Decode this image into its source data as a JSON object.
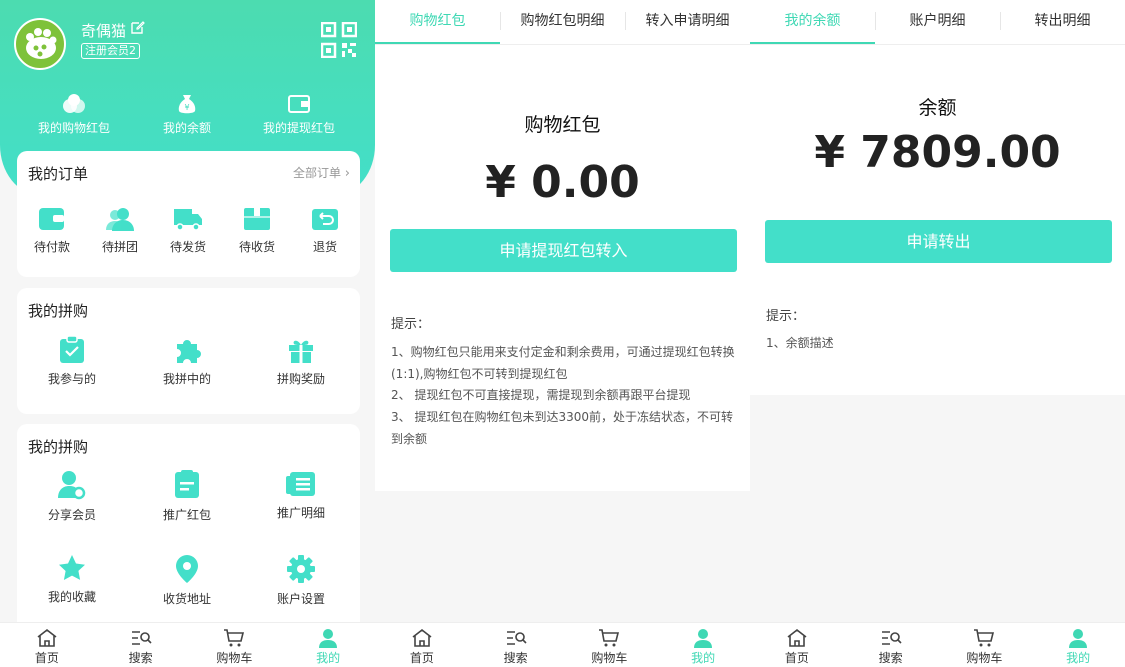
{
  "profile": {
    "username": "奇偶猫",
    "member_level": "注册会员2",
    "quick_links": [
      "我的购物红包",
      "我的余额",
      "我的提现红包"
    ]
  },
  "orders": {
    "title": "我的订单",
    "more": "全部订单",
    "items": [
      "待付款",
      "待拼团",
      "待发货",
      "待收货",
      "退货"
    ]
  },
  "group_buy": {
    "title": "我的拼购",
    "items": [
      "我参与的",
      "我拼中的",
      "拼购奖励"
    ]
  },
  "promo": {
    "title": "我的拼购",
    "items": [
      "分享会员",
      "推广红包",
      "推广明细",
      "我的收藏",
      "收货地址",
      "账户设置"
    ]
  },
  "tabbar": {
    "items": [
      "首页",
      "搜索",
      "购物车",
      "我的"
    ],
    "active": "我的"
  },
  "redpacket": {
    "tabs": [
      "购物红包",
      "购物红包明细",
      "转入申请明细"
    ],
    "title": "购物红包",
    "amount": "¥ 0.00",
    "button": "申请提现红包转入",
    "tip_title": "提示：",
    "tips": [
      "1、购物红包只能用来支付定金和剩余费用，可通过提现红包转换(1:1),购物红包不可转到提现红包",
      "2、 提现红包不可直接提现，需提现到余额再跟平台提现",
      "3、 提现红包在购物红包未到达3300前，处于冻结状态，不可转到余额"
    ]
  },
  "balance": {
    "tabs": [
      "我的余额",
      "账户明细",
      "转出明细"
    ],
    "title": "余额",
    "amount": "¥ 7809.00",
    "button": "申请转出",
    "tip_title": "提示：",
    "tips": [
      "1、余额描述"
    ]
  },
  "colors": {
    "accent": "#43dfc9",
    "hero_top": "#4cdcb0",
    "active_text": "#3fd8b4"
  }
}
